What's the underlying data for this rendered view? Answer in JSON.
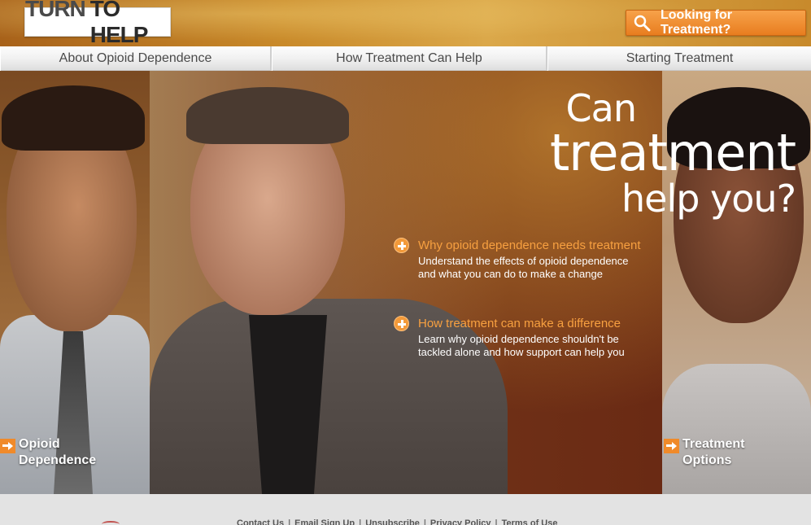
{
  "header": {
    "logo": {
      "part1": "TURN",
      "part2": "TO HELP"
    },
    "find_button_label": "Looking for Treatment?",
    "find_button_icon": "search-icon"
  },
  "nav": {
    "items": [
      {
        "label": "About Opioid Dependence"
      },
      {
        "label": "How Treatment Can Help"
      },
      {
        "label": "Starting Treatment"
      }
    ]
  },
  "hero": {
    "headline": {
      "line1": "Can",
      "line2": "treatment",
      "line3": "help you?"
    },
    "features": [
      {
        "title": "Why opioid dependence needs treatment",
        "description": "Understand the effects of opioid dependence and what you can do to make a change",
        "icon": "plus-circle-icon"
      },
      {
        "title": "How treatment can make a difference",
        "description": "Learn why opioid dependence shouldn't be tackled alone and how support can help you",
        "icon": "plus-circle-icon"
      }
    ],
    "side_links": {
      "left": {
        "line1": "Opioid",
        "line2": "Dependence",
        "icon": "arrow-right-icon"
      },
      "right": {
        "line1": "Treatment",
        "line2": "Options",
        "icon": "arrow-right-icon"
      }
    }
  },
  "footer": {
    "links": [
      "Contact Us",
      "Email Sign Up",
      "Unsubscribe",
      "Privacy Policy",
      "Terms of Use"
    ],
    "separator": "|"
  },
  "colors": {
    "accent_orange": "#f39a3a",
    "nav_text": "#4a4a4a",
    "footer_bg": "#e3e3e3"
  }
}
